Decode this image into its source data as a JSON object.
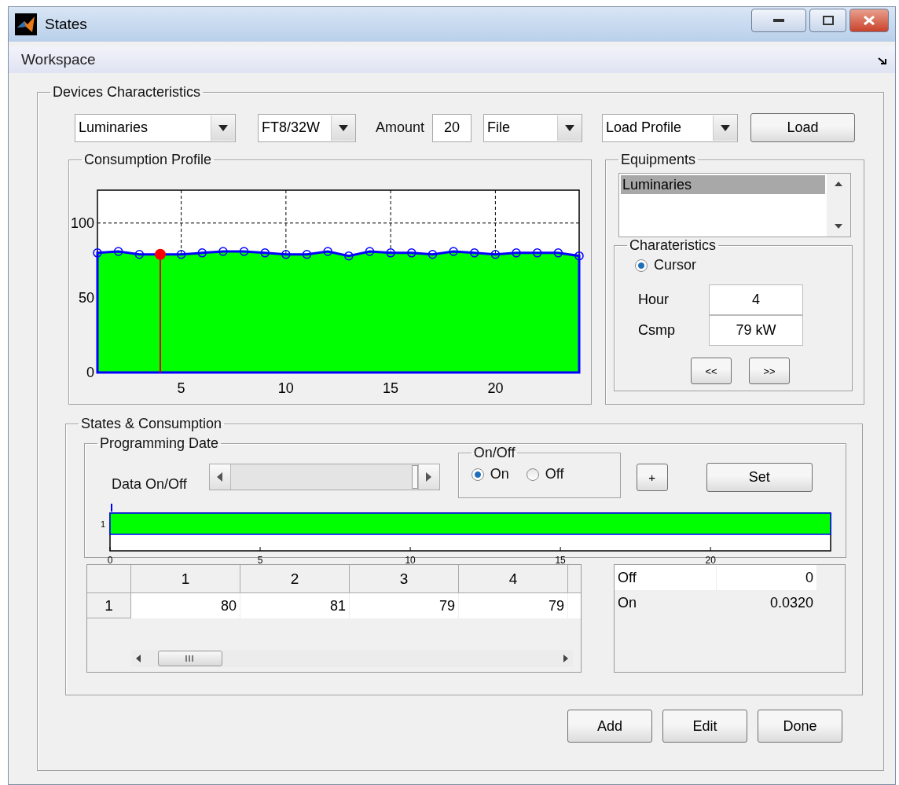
{
  "window": {
    "title": "States"
  },
  "menu": {
    "label": "Workspace"
  },
  "devices": {
    "title": "Devices Characteristics",
    "device_type": {
      "value": "Luminaries"
    },
    "model": {
      "value": "FT8/32W"
    },
    "amount": {
      "label": "Amount",
      "value": "20"
    },
    "source": {
      "value": "File"
    },
    "profile": {
      "value": "Load Profile"
    },
    "load_button": "Load"
  },
  "consumption_profile": {
    "title": "Consumption Profile",
    "chart_data": {
      "type": "area",
      "x": [
        1,
        2,
        3,
        4,
        5,
        6,
        7,
        8,
        9,
        10,
        11,
        12,
        13,
        14,
        15,
        16,
        17,
        18,
        19,
        20,
        21,
        22,
        23,
        24
      ],
      "series": [
        {
          "color": "#00ff00",
          "values": [
            80,
            81,
            79,
            79,
            79,
            80,
            81,
            81,
            80,
            79,
            79,
            81,
            78,
            81,
            80,
            80,
            79,
            81,
            80,
            79,
            80,
            80,
            80,
            78
          ]
        }
      ],
      "xlim": [
        1,
        24
      ],
      "ylim": [
        0,
        122
      ],
      "xticks": [
        5,
        10,
        15,
        20
      ],
      "yticks": [
        0,
        50,
        100
      ],
      "grid": true,
      "ref_lines": [
        {
          "axis": "x",
          "value": 4,
          "color": "#e00000"
        }
      ]
    }
  },
  "equipments": {
    "title": "Equipments",
    "items": [
      {
        "label": "Luminaries",
        "selected": true
      }
    ]
  },
  "characteristics": {
    "title": "Charateristics",
    "cursor": {
      "label": "Cursor",
      "selected": true
    },
    "fields": [
      {
        "label": "Hour",
        "value": "4"
      },
      {
        "label": "Csmp",
        "value": "79 kW"
      }
    ],
    "prev_button": "<<",
    "next_button": ">>"
  },
  "states": {
    "title": "States & Consumption",
    "programming": {
      "title": "Programming Date",
      "data_label": "Data On/Off",
      "slider": {
        "level": 1
      },
      "on_off": {
        "title": "On/Off",
        "options": [
          {
            "label": "On",
            "selected": true
          },
          {
            "label": "Off",
            "selected": false
          }
        ]
      },
      "plus_button": "+",
      "set_button": "Set",
      "chart_data": {
        "type": "bar",
        "orientation": "horizontal",
        "categories": [
          "1"
        ],
        "values": [
          24
        ],
        "xlim": [
          0,
          24
        ],
        "xticks": [
          0,
          5,
          10,
          15,
          20
        ]
      }
    },
    "values_table": {
      "columns": [
        "1",
        "2",
        "3",
        "4"
      ],
      "rows": [
        {
          "header": "1",
          "cells": [
            "80",
            "81",
            "79",
            "79"
          ]
        }
      ]
    },
    "state_table": {
      "rows": [
        {
          "label": "Off",
          "value": "0"
        },
        {
          "label": "On",
          "value": "0.0320"
        }
      ]
    }
  },
  "buttons": [
    "Add",
    "Edit",
    "Done"
  ]
}
